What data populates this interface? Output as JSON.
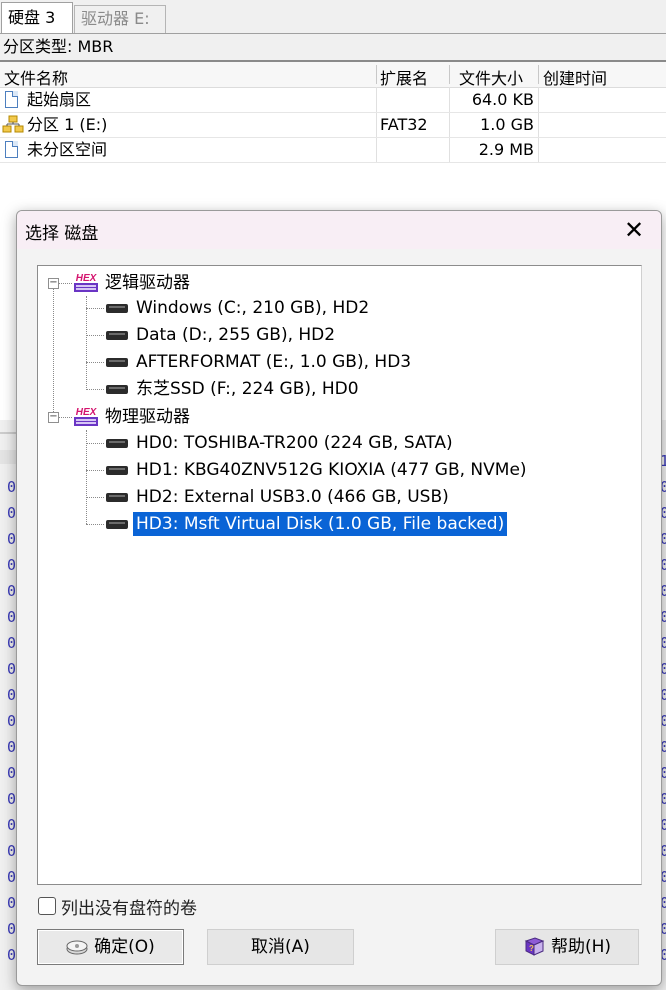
{
  "tabs": [
    {
      "label": "硬盘 3"
    },
    {
      "label": "驱动器 E:"
    }
  ],
  "partition_type": "分区类型: MBR",
  "table": {
    "headers": {
      "name": "文件名称",
      "ext": "扩展名",
      "size": "文件大小",
      "created": "创建时间"
    },
    "rows": [
      {
        "name": "起始扇区",
        "ext": "",
        "size": "64.0 KB",
        "created": ""
      },
      {
        "name": "分区 1 (E:)",
        "ext": "FAT32",
        "size": "1.0 GB",
        "created": ""
      },
      {
        "name": "未分区空间",
        "ext": "",
        "size": "2.9 MB",
        "created": ""
      }
    ]
  },
  "background_hex": {
    "left_char": "0",
    "right_char": "0",
    "right_top_char": "1"
  },
  "dialog": {
    "title": "选择 磁盘",
    "close": "✕",
    "tree": {
      "logical": {
        "label": "逻辑驱动器",
        "icon_text": "HEX",
        "expander": "−",
        "items": [
          "Windows (C:, 210 GB), HD2",
          "Data (D:, 255 GB), HD2",
          "AFTERFORMAT (E:, 1.0 GB), HD3",
          "东芝SSD (F:, 224 GB), HD0"
        ]
      },
      "physical": {
        "label": "物理驱动器",
        "icon_text": "HEX",
        "expander": "−",
        "items": [
          "HD0: TOSHIBA-TR200 (224 GB, SATA)",
          "HD1: KBG40ZNV512G KIOXIA (477 GB, NVMe)",
          "HD2: External USB3.0 (466 GB, USB)",
          "HD3: Msft Virtual Disk (1.0 GB, File backed)"
        ],
        "selected_index": 3
      }
    },
    "checkbox_label": "列出没有盘符的卷",
    "buttons": {
      "ok": "确定(O)",
      "cancel": "取消(A)",
      "help": "帮助(H)"
    }
  }
}
